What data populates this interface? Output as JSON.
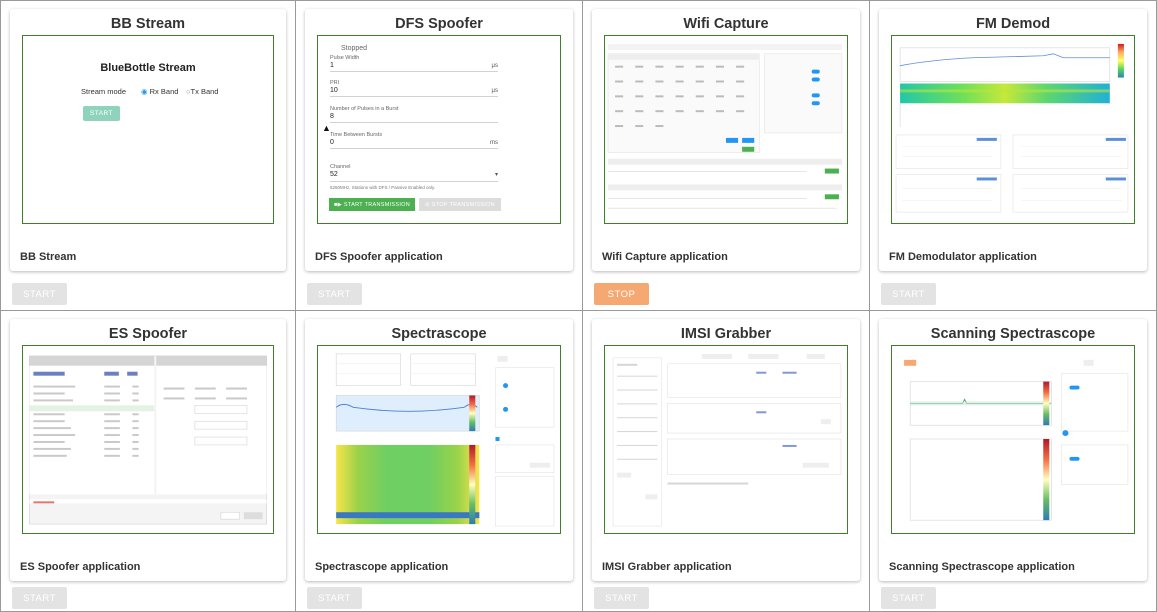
{
  "cards": [
    {
      "title": "BB Stream",
      "desc": "BB Stream",
      "button": "START",
      "button_state": "disabled"
    },
    {
      "title": "DFS Spoofer",
      "desc": "DFS Spoofer application",
      "button": "START",
      "button_state": "disabled"
    },
    {
      "title": "Wifi Capture",
      "desc": "Wifi Capture application",
      "button": "STOP",
      "button_state": "active"
    },
    {
      "title": "FM Demod",
      "desc": "FM Demodulator application",
      "button": "START",
      "button_state": "disabled"
    },
    {
      "title": "ES Spoofer",
      "desc": "ES Spoofer application",
      "button": "START",
      "button_state": "disabled"
    },
    {
      "title": "Spectrascope",
      "desc": "Spectrascope application",
      "button": "START",
      "button_state": "disabled"
    },
    {
      "title": "IMSI Grabber",
      "desc": "IMSI Grabber application",
      "button": "START",
      "button_state": "disabled"
    },
    {
      "title": "Scanning Spectrascope",
      "desc": "Scanning Spectrascope application",
      "button": "START",
      "button_state": "disabled"
    }
  ],
  "bb_preview": {
    "title": "BlueBottle Stream",
    "mode_label": "Stream mode",
    "opt_rx": "Rx Band",
    "opt_tx": "Tx Band",
    "start": "START"
  },
  "dfs_preview": {
    "status": "Stopped",
    "fields": [
      {
        "label": "Pulse Width",
        "value": "1",
        "unit": "μs"
      },
      {
        "label": "PRI",
        "value": "10",
        "unit": "μs"
      },
      {
        "label": "Number of Pulses in a Burst",
        "value": "8",
        "unit": ""
      },
      {
        "label": "Time Between Bursts",
        "value": "0",
        "unit": "ms"
      },
      {
        "label": "Channel",
        "value": "52",
        "unit": "▾"
      }
    ],
    "note": "5260MHz. Stations with DFS / Passive Enabled only.",
    "start_tx": "START TRANSMISSION",
    "stop_tx": "STOP TRANSMISSION"
  },
  "colors": {
    "frame": "#3f7f2c",
    "stop": "#f6a873",
    "start_disabled": "#e3e3e3",
    "bb_start": "#8fd3bd",
    "dfs_start": "#4caf50"
  }
}
